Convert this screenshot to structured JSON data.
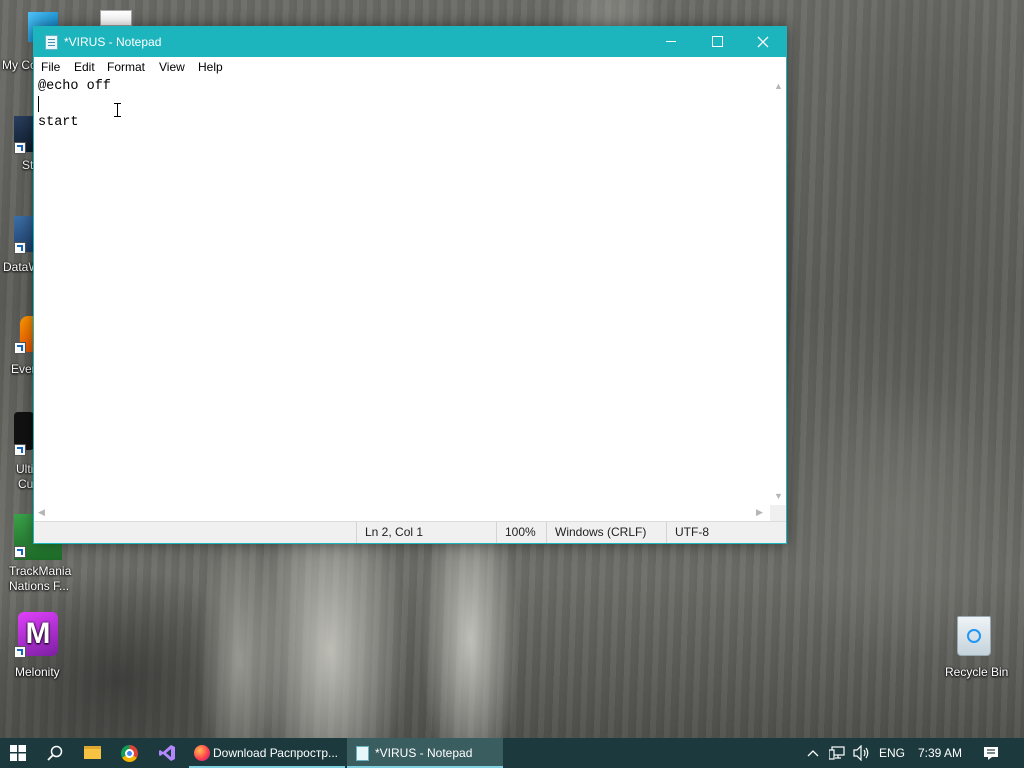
{
  "desktop": {
    "icons": [
      {
        "label": "My Co"
      },
      {
        "label": "St"
      },
      {
        "label": "DataW"
      },
      {
        "label": "Ever"
      },
      {
        "label": "Ulti"
      },
      {
        "label": "Cu"
      },
      {
        "label": "TrackMania"
      },
      {
        "label": "Nations F..."
      },
      {
        "label": "Melonity"
      },
      {
        "label": "Recycle Bin"
      }
    ]
  },
  "window": {
    "title": "*VIRUS - Notepad",
    "accent_color": "#1cb4bd",
    "controls": [
      "minimize-icon",
      "maximize-icon",
      "close-icon"
    ]
  },
  "menu": [
    "File",
    "Edit",
    "Format",
    "View",
    "Help"
  ],
  "editor": {
    "lines": [
      "@echo off",
      "",
      "start"
    ]
  },
  "status": {
    "position": "Ln 2, Col 1",
    "zoom": "100%",
    "line_ending": "Windows (CRLF)",
    "encoding": "UTF-8"
  },
  "taskbar": {
    "pinned": [
      "windows-start-icon",
      "search-icon",
      "file-explorer-icon",
      "chrome-icon",
      "visual-studio-icon"
    ],
    "apps": [
      {
        "label": "Download Распростр...",
        "icon": "firefox-icon"
      },
      {
        "label": "*VIRUS - Notepad",
        "icon": "notepad-icon"
      }
    ],
    "tray": {
      "language": "ENG",
      "time": "7:39 AM"
    },
    "background_color": "#1c3a3d"
  }
}
